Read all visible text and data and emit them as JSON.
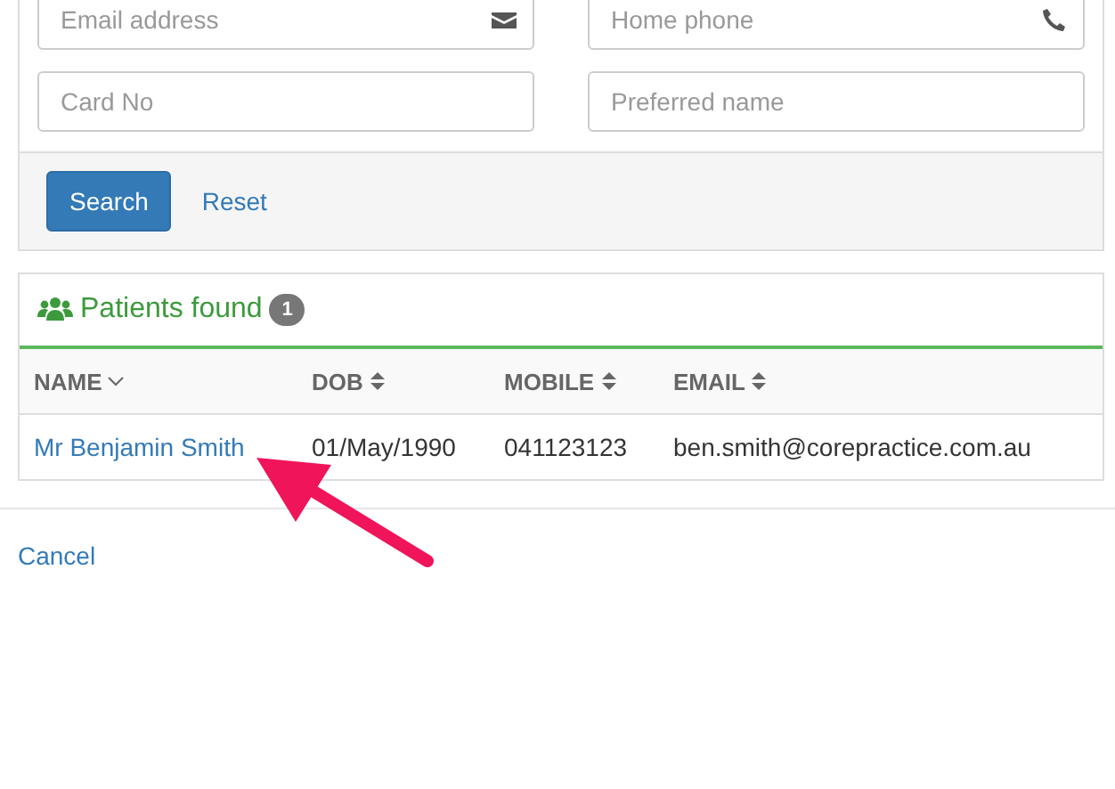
{
  "search_form": {
    "fields": [
      {
        "placeholder": "Email address",
        "kind": "email"
      },
      {
        "placeholder": "Home phone",
        "kind": "phone"
      },
      {
        "placeholder": "Card No"
      },
      {
        "placeholder": "Preferred name"
      }
    ],
    "buttons": [
      {
        "label": "Search",
        "kind": "primary"
      },
      {
        "label": "Reset",
        "kind": "link"
      }
    ]
  },
  "results": {
    "title": "Patients found",
    "count": "1",
    "table": {
      "columns": [
        {
          "label": "NAME",
          "sorted": true
        },
        {
          "label": "DOB",
          "sorted": false
        },
        {
          "label": "MOBILE",
          "sorted": false
        },
        {
          "label": "EMAIL",
          "sorted": false
        }
      ],
      "rows": [
        [
          "Mr Benjamin Smith",
          "01/May/1990",
          "041123123",
          "ben.smith@corepractice.com.au"
        ]
      ]
    }
  },
  "cancel": "Cancel"
}
